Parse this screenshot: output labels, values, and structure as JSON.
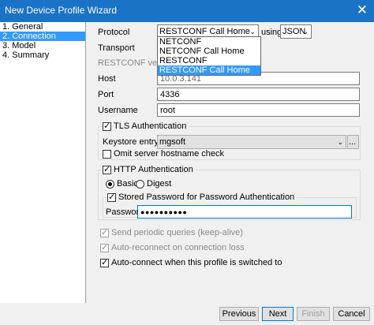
{
  "window": {
    "title": "New Device Profile Wizard",
    "close_glyph": "✕"
  },
  "steps": [
    {
      "label": "1. General"
    },
    {
      "label": "2. Connection"
    },
    {
      "label": "3. Model"
    },
    {
      "label": "4. Summary"
    }
  ],
  "form": {
    "protocol_label": "Protocol",
    "protocol_value": "RESTCONF Call Home",
    "using_label": "using",
    "encoding_value": "JSON",
    "protocol_options": [
      "NETCONF",
      "NETCONF Call Home",
      "RESTCONF",
      "RESTCONF Call Home"
    ],
    "transport_label": "Transport",
    "restconf_version_label": "RESTCONF version",
    "host_label": "Host",
    "host_value": "10.0.3.141",
    "port_label": "Port",
    "port_value": "4336",
    "username_label": "Username",
    "username_value": "root"
  },
  "tls": {
    "label": "TLS Authentication",
    "checked": true,
    "keystore_label": "Keystore entry",
    "keystore_value": "mgsoft",
    "browse_label": "...",
    "omit_hostname_label": "Omit server hostname check"
  },
  "http": {
    "label": "HTTP Authentication",
    "checked": true,
    "basic_label": "Basic",
    "digest_label": "Digest",
    "selected": "Basic",
    "stored_password_label": "Stored Password for Password Authentication",
    "password_label": "Password",
    "password_value": "●●●●●●●●●●"
  },
  "options": {
    "keepalive_label": "Send periodic queries (keep-alive)",
    "auto_reconnect_label": "Auto-reconnect on connection loss",
    "auto_connect_label": "Auto-connect when this profile is switched to"
  },
  "buttons": {
    "previous": "Previous",
    "next": "Next",
    "finish": "Finish",
    "cancel": "Cancel"
  },
  "colors": {
    "titlebar": "#1a73c6",
    "selection": "#3399ff",
    "disabled_text": "#8a8a8a"
  },
  "glyphs": {
    "check": "✓",
    "dropdown_arrow": "⌄"
  }
}
